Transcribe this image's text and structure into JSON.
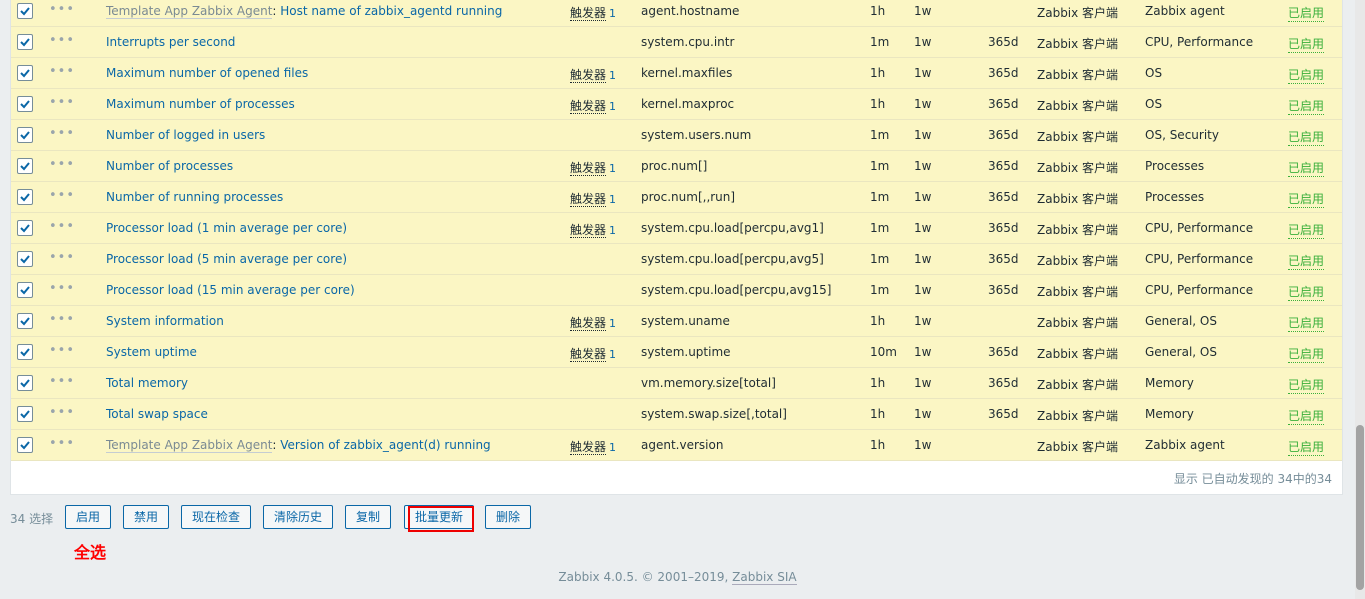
{
  "rows": [
    {
      "tpl": "Template App Zabbix Agent",
      "name": "Host name of zabbix_agentd running",
      "trg": "触发器",
      "trgc": "1",
      "key": "agent.hostname",
      "int": "1h",
      "his": "1w",
      "tre": "",
      "typ": "Zabbix 客户端",
      "app": "Zabbix agent",
      "st": "已启用"
    },
    {
      "tpl": "",
      "name": "Interrupts per second",
      "trg": "",
      "trgc": "",
      "key": "system.cpu.intr",
      "int": "1m",
      "his": "1w",
      "tre": "365d",
      "typ": "Zabbix 客户端",
      "app": "CPU, Performance",
      "st": "已启用"
    },
    {
      "tpl": "",
      "name": "Maximum number of opened files",
      "trg": "触发器",
      "trgc": "1",
      "key": "kernel.maxfiles",
      "int": "1h",
      "his": "1w",
      "tre": "365d",
      "typ": "Zabbix 客户端",
      "app": "OS",
      "st": "已启用"
    },
    {
      "tpl": "",
      "name": "Maximum number of processes",
      "trg": "触发器",
      "trgc": "1",
      "key": "kernel.maxproc",
      "int": "1h",
      "his": "1w",
      "tre": "365d",
      "typ": "Zabbix 客户端",
      "app": "OS",
      "st": "已启用"
    },
    {
      "tpl": "",
      "name": "Number of logged in users",
      "trg": "",
      "trgc": "",
      "key": "system.users.num",
      "int": "1m",
      "his": "1w",
      "tre": "365d",
      "typ": "Zabbix 客户端",
      "app": "OS, Security",
      "st": "已启用"
    },
    {
      "tpl": "",
      "name": "Number of processes",
      "trg": "触发器",
      "trgc": "1",
      "key": "proc.num[]",
      "int": "1m",
      "his": "1w",
      "tre": "365d",
      "typ": "Zabbix 客户端",
      "app": "Processes",
      "st": "已启用"
    },
    {
      "tpl": "",
      "name": "Number of running processes",
      "trg": "触发器",
      "trgc": "1",
      "key": "proc.num[,,run]",
      "int": "1m",
      "his": "1w",
      "tre": "365d",
      "typ": "Zabbix 客户端",
      "app": "Processes",
      "st": "已启用"
    },
    {
      "tpl": "",
      "name": "Processor load (1 min average per core)",
      "trg": "触发器",
      "trgc": "1",
      "key": "system.cpu.load[percpu,avg1]",
      "int": "1m",
      "his": "1w",
      "tre": "365d",
      "typ": "Zabbix 客户端",
      "app": "CPU, Performance",
      "st": "已启用"
    },
    {
      "tpl": "",
      "name": "Processor load (5 min average per core)",
      "trg": "",
      "trgc": "",
      "key": "system.cpu.load[percpu,avg5]",
      "int": "1m",
      "his": "1w",
      "tre": "365d",
      "typ": "Zabbix 客户端",
      "app": "CPU, Performance",
      "st": "已启用"
    },
    {
      "tpl": "",
      "name": "Processor load (15 min average per core)",
      "trg": "",
      "trgc": "",
      "key": "system.cpu.load[percpu,avg15]",
      "int": "1m",
      "his": "1w",
      "tre": "365d",
      "typ": "Zabbix 客户端",
      "app": "CPU, Performance",
      "st": "已启用"
    },
    {
      "tpl": "",
      "name": "System information",
      "trg": "触发器",
      "trgc": "1",
      "key": "system.uname",
      "int": "1h",
      "his": "1w",
      "tre": "",
      "typ": "Zabbix 客户端",
      "app": "General, OS",
      "st": "已启用"
    },
    {
      "tpl": "",
      "name": "System uptime",
      "trg": "触发器",
      "trgc": "1",
      "key": "system.uptime",
      "int": "10m",
      "his": "1w",
      "tre": "365d",
      "typ": "Zabbix 客户端",
      "app": "General, OS",
      "st": "已启用"
    },
    {
      "tpl": "",
      "name": "Total memory",
      "trg": "",
      "trgc": "",
      "key": "vm.memory.size[total]",
      "int": "1h",
      "his": "1w",
      "tre": "365d",
      "typ": "Zabbix 客户端",
      "app": "Memory",
      "st": "已启用"
    },
    {
      "tpl": "",
      "name": "Total swap space",
      "trg": "",
      "trgc": "",
      "key": "system.swap.size[,total]",
      "int": "1h",
      "his": "1w",
      "tre": "365d",
      "typ": "Zabbix 客户端",
      "app": "Memory",
      "st": "已启用"
    },
    {
      "tpl": "Template App Zabbix Agent",
      "name": "Version of zabbix_agent(d) running",
      "trg": "触发器",
      "trgc": "1",
      "key": "agent.version",
      "int": "1h",
      "his": "1w",
      "tre": "",
      "typ": "Zabbix 客户端",
      "app": "Zabbix agent",
      "st": "已启用"
    }
  ],
  "footer": "显示 已自动发现的 34中的34",
  "selected": "34 选择",
  "buttons": [
    "启用",
    "禁用",
    "现在检查",
    "清除历史",
    "复制",
    "批量更新",
    "删除"
  ],
  "annotation": "全选",
  "copyright": "Zabbix 4.0.5. © 2001–2019,",
  "copyright_link": "Zabbix SIA",
  "colors": {
    "link": "#0a67a7",
    "row_bg": "#fbf6c4",
    "enabled": "#3bb03b",
    "highlight": "#ee0000"
  }
}
